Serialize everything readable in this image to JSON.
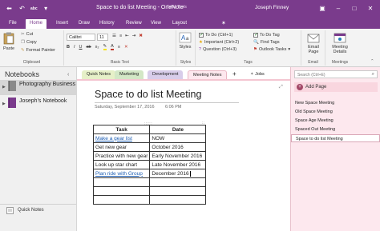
{
  "window": {
    "title": "Space to do list Meeting - OneNote",
    "context_group": "Table Tools",
    "account": "Joseph Finney",
    "qat_text": "abc"
  },
  "ribbon_tabs": [
    "File",
    "Home",
    "Insert",
    "Draw",
    "History",
    "Review",
    "View",
    "Layout"
  ],
  "active_tab": "Home",
  "ribbon": {
    "clipboard": {
      "paste": "Paste",
      "cut": "Cut",
      "copy": "Copy",
      "format_painter": "Format Painter",
      "group": "Clipboard"
    },
    "basic_text": {
      "font": "Calibri",
      "size": "11",
      "group": "Basic Text"
    },
    "styles": {
      "label": "Styles",
      "group": "Styles"
    },
    "tags": {
      "items": [
        "To Do (Ctrl+1)",
        "Important (Ctrl+2)",
        "Question (Ctrl+3)"
      ],
      "todo_tag": "To Do Tag",
      "find_tags": "Find Tags",
      "outlook_tasks": "Outlook Tasks",
      "group": "Tags"
    },
    "email": {
      "label": "Email Page",
      "group": "Email"
    },
    "meetings": {
      "label": "Meeting Details",
      "group": "Meetings"
    }
  },
  "notebooks": {
    "header": "Notebooks",
    "items": [
      {
        "name": "Photography Business",
        "color": "#8a8a8a"
      },
      {
        "name": "Joseph's Notebook",
        "color": "#7a3b8c"
      }
    ],
    "quick_notes": "Quick Notes"
  },
  "sections": [
    {
      "name": "Quick Notes",
      "color": "#e6f0c8"
    },
    {
      "name": "Marketing",
      "color": "#d3e7c6"
    },
    {
      "name": "Development",
      "color": "#d8cdea"
    },
    {
      "name": "Meeting Notes",
      "color": "#fde8ee"
    },
    {
      "name": "Jobs",
      "color": "#ffffff"
    }
  ],
  "page": {
    "title": "Space to do list Meeting",
    "date": "Saturday, September 17, 2016",
    "time": "6:06 PM",
    "table": {
      "headers": [
        "Task",
        "Date"
      ],
      "rows": [
        [
          "Make a gear list",
          "NOW"
        ],
        [
          "Get new gear",
          "October 2016"
        ],
        [
          "Practice with new gear",
          "Early November 2016"
        ],
        [
          "Look up star chart",
          "Late November 2016"
        ],
        [
          "Plan ride with Group",
          "December 2016"
        ],
        [
          "",
          ""
        ],
        [
          "",
          ""
        ],
        [
          "",
          ""
        ]
      ]
    }
  },
  "pages_pane": {
    "search_placeholder": "Search (Ctrl+E)",
    "add_page": "Add Page",
    "pages": [
      "New Space Meeting",
      "Old Space Meeting",
      "Space Age Meeting",
      "Spaced Out Meeting",
      "Space to do list Meeting"
    ]
  },
  "colors": {
    "accent": "#7a3b8c",
    "section_active": "#fde8ee",
    "link": "#1f5fb4"
  }
}
